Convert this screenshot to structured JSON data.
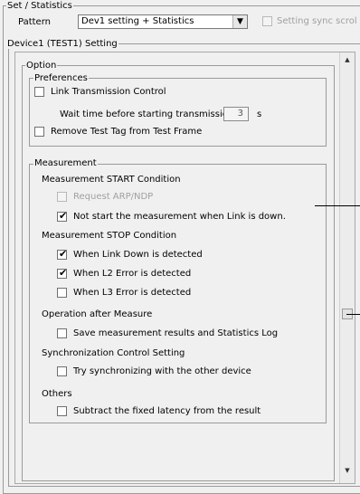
{
  "set_statistics": {
    "group_label": "Set / Statistics",
    "pattern_label": "Pattern",
    "pattern_value": "Dev1 setting + Statistics",
    "setting_sync_label": "Setting sync scrol"
  },
  "device": {
    "group_label": "Device1 (TEST1) Setting"
  },
  "option": {
    "group_label": "Option"
  },
  "preferences": {
    "group_label": "Preferences",
    "link_transmission_control": {
      "label": "Link Transmission Control",
      "checked": false
    },
    "wait_time_label": "Wait time before starting transmission",
    "wait_time_value": "3",
    "wait_time_unit": "s",
    "remove_test_tag": {
      "label": "Remove Test Tag from Test Frame",
      "checked": false
    }
  },
  "measurement": {
    "group_label": "Measurement",
    "start_condition_label": "Measurement START Condition",
    "request_arp": {
      "label": "Request ARP/NDP",
      "checked": false,
      "enabled": false
    },
    "not_start_link_down": {
      "label": "Not start the measurement when Link is down.",
      "checked": true
    },
    "stop_condition_label": "Measurement STOP Condition",
    "when_link_down": {
      "label": "When Link Down is detected",
      "checked": true
    },
    "when_l2_error": {
      "label": "When L2 Error is detected",
      "checked": true
    },
    "when_l3_error": {
      "label": "When L3 Error is detected",
      "checked": false
    },
    "operation_after_label": "Operation after Measure",
    "save_results": {
      "label": "Save measurement results and Statistics Log",
      "checked": false
    },
    "sync_control_label": "Synchronization Control Setting",
    "try_sync": {
      "label": "Try synchronizing with the other device",
      "checked": false
    },
    "others_label": "Others",
    "subtract_latency": {
      "label": "Subtract the fixed latency from the result",
      "checked": false
    }
  },
  "icons": {
    "checkmark": "✔",
    "dropdown": "▼",
    "scroll_up": "▲",
    "scroll_down": "▼"
  }
}
